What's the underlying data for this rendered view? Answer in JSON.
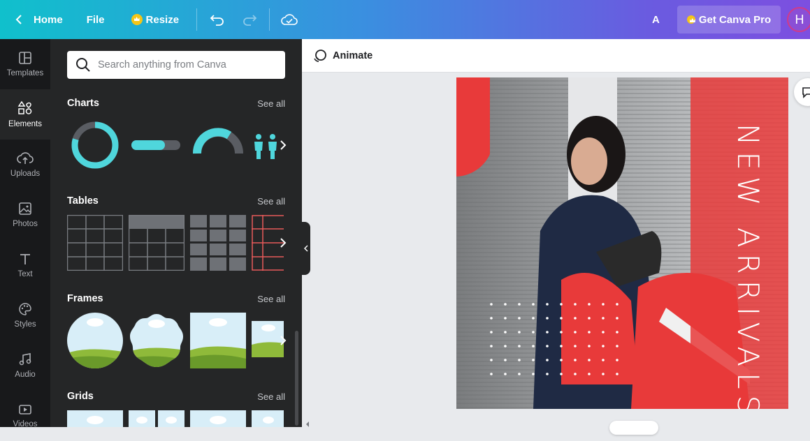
{
  "topbar": {
    "home_label": "Home",
    "file_label": "File",
    "resize_label": "Resize",
    "user_initial_a": "A",
    "pro_label": "Get Canva Pro",
    "avatar_initial": "H"
  },
  "rail": {
    "items": [
      {
        "label": "Templates",
        "icon": "templates-icon"
      },
      {
        "label": "Elements",
        "icon": "elements-icon",
        "active": true
      },
      {
        "label": "Uploads",
        "icon": "upload-cloud-icon"
      },
      {
        "label": "Photos",
        "icon": "photo-icon"
      },
      {
        "label": "Text",
        "icon": "text-icon"
      },
      {
        "label": "Styles",
        "icon": "palette-icon"
      },
      {
        "label": "Audio",
        "icon": "music-note-icon"
      },
      {
        "label": "Videos",
        "icon": "video-icon"
      }
    ]
  },
  "panel": {
    "search_placeholder": "Search anything from Canva",
    "sections": [
      {
        "title": "Charts",
        "see_all": "See all"
      },
      {
        "title": "Tables",
        "see_all": "See all"
      },
      {
        "title": "Frames",
        "see_all": "See all"
      },
      {
        "title": "Grids",
        "see_all": "See all"
      }
    ]
  },
  "editor": {
    "animate_label": "Animate",
    "design_text": "NEW ARRIVALS"
  },
  "colors": {
    "accent_teal": "#4fd6dc",
    "design_red": "#e83a3a",
    "panel_bg": "#252627",
    "rail_bg": "#18191b"
  }
}
